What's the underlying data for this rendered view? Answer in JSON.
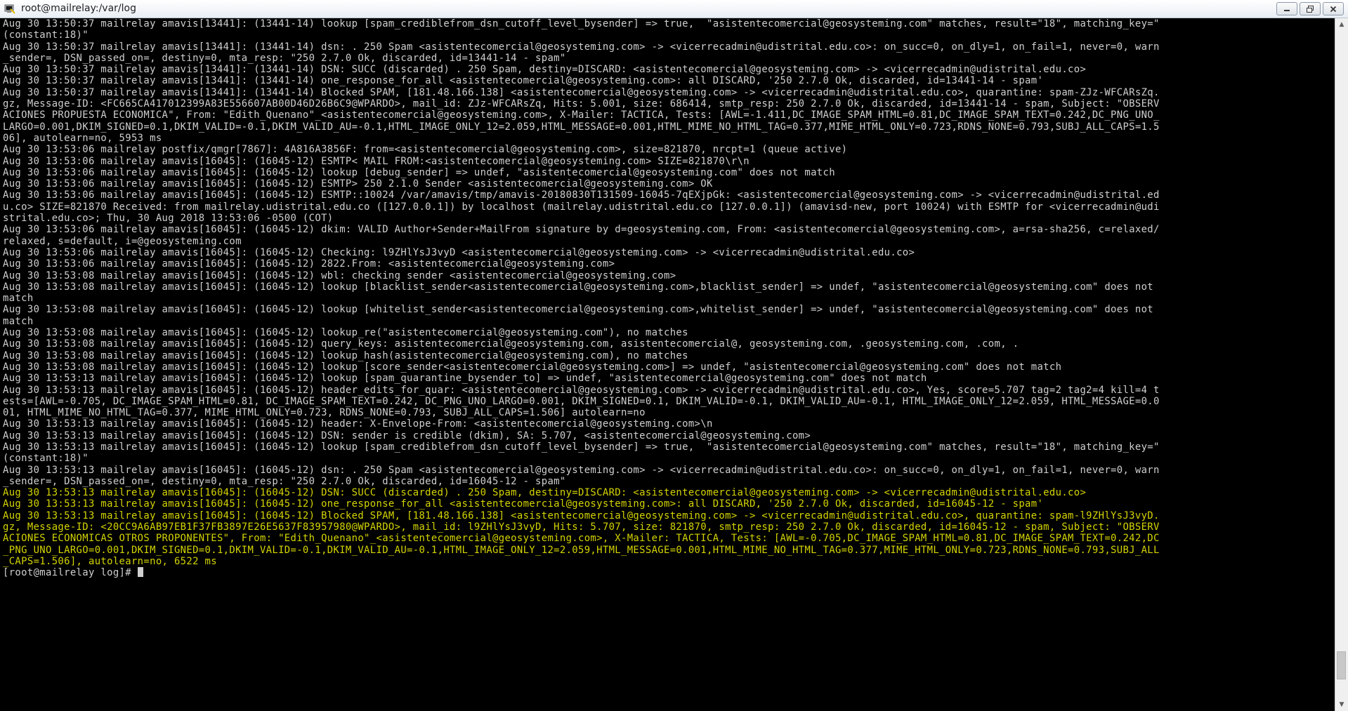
{
  "window": {
    "title": "root@mailrelay:/var/log",
    "icons": {
      "app": "putty-terminal-icon",
      "minimize": "minimize-icon",
      "maximize": "maximize-icon",
      "close": "close-icon"
    }
  },
  "terminal": {
    "scroll_position": 0.97,
    "lines": [
      {
        "text": "Aug 30 13:50:37 mailrelay amavis[13441]: (13441-14) lookup [spam_crediblefrom_dsn_cutoff_level_bysender] => true,  \"asistentecomercial@geosysteming.com\" matches, result=\"18\", matching_key=\"",
        "hl": false
      },
      {
        "text": "(constant:18)\"",
        "hl": false
      },
      {
        "text": "Aug 30 13:50:37 mailrelay amavis[13441]: (13441-14) dsn: . 250 Spam <asistentecomercial@geosysteming.com> -> <vicerrecadmin@udistrital.edu.co>: on_succ=0, on_dly=1, on_fail=1, never=0, warn",
        "hl": false
      },
      {
        "text": "_sender=, DSN_passed_on=, destiny=0, mta_resp: \"250 2.7.0 Ok, discarded, id=13441-14 - spam\"",
        "hl": false
      },
      {
        "text": "Aug 30 13:50:37 mailrelay amavis[13441]: (13441-14) DSN: SUCC (discarded) . 250 Spam, destiny=DISCARD: <asistentecomercial@geosysteming.com> -> <vicerrecadmin@udistrital.edu.co>",
        "hl": false
      },
      {
        "text": "Aug 30 13:50:37 mailrelay amavis[13441]: (13441-14) one_response_for_all <asistentecomercial@geosysteming.com>: all DISCARD, '250 2.7.0 Ok, discarded, id=13441-14 - spam'",
        "hl": false
      },
      {
        "text": "Aug 30 13:50:37 mailrelay amavis[13441]: (13441-14) Blocked SPAM, [181.48.166.138] <asistentecomercial@geosysteming.com> -> <vicerrecadmin@udistrital.edu.co>, quarantine: spam-ZJz-WFCARsZq.",
        "hl": false
      },
      {
        "text": "gz, Message-ID: <FC665CA417012399A83E556607AB00D46D26B6C9@WPARDO>, mail_id: ZJz-WFCARsZq, Hits: 5.001, size: 686414, smtp_resp: 250 2.7.0 Ok, discarded, id=13441-14 - spam, Subject: \"OBSERV",
        "hl": false
      },
      {
        "text": "ACIONES PROPUESTA ECONOMICA\", From: \"Edith_Quenano\"_<asistentecomercial@geosysteming.com>, X-Mailer: TACTICA, Tests: [AWL=-1.411,DC_IMAGE_SPAM_HTML=0.81,DC_IMAGE_SPAM_TEXT=0.242,DC_PNG_UNO_",
        "hl": false
      },
      {
        "text": "LARGO=0.001,DKIM_SIGNED=0.1,DKIM_VALID=-0.1,DKIM_VALID_AU=-0.1,HTML_IMAGE_ONLY_12=2.059,HTML_MESSAGE=0.001,HTML_MIME_NO_HTML_TAG=0.377,MIME_HTML_ONLY=0.723,RDNS_NONE=0.793,SUBJ_ALL_CAPS=1.5",
        "hl": false
      },
      {
        "text": "06], autolearn=no, 5953 ms",
        "hl": false
      },
      {
        "text": "Aug 30 13:53:06 mailrelay postfix/qmgr[7867]: 4A816A3856F: from=<asistentecomercial@geosysteming.com>, size=821870, nrcpt=1 (queue active)",
        "hl": false
      },
      {
        "text": "Aug 30 13:53:06 mailrelay amavis[16045]: (16045-12) ESMTP< MAIL FROM:<asistentecomercial@geosysteming.com> SIZE=821870\\r\\n",
        "hl": false
      },
      {
        "text": "Aug 30 13:53:06 mailrelay amavis[16045]: (16045-12) lookup [debug_sender] => undef, \"asistentecomercial@geosysteming.com\" does not match",
        "hl": false
      },
      {
        "text": "Aug 30 13:53:06 mailrelay amavis[16045]: (16045-12) ESMTP> 250 2.1.0 Sender <asistentecomercial@geosysteming.com> OK",
        "hl": false
      },
      {
        "text": "Aug 30 13:53:06 mailrelay amavis[16045]: (16045-12) ESMTP::10024 /var/amavis/tmp/amavis-20180830T131509-16045-7qEXjpGk: <asistentecomercial@geosysteming.com> -> <vicerrecadmin@udistrital.ed",
        "hl": false
      },
      {
        "text": "u.co> SIZE=821870 Received: from mailrelay.udistrital.edu.co ([127.0.0.1]) by localhost (mailrelay.udistrital.edu.co [127.0.0.1]) (amavisd-new, port 10024) with ESMTP for <vicerrecadmin@udi",
        "hl": false
      },
      {
        "text": "strital.edu.co>; Thu, 30 Aug 2018 13:53:06 -0500 (COT)",
        "hl": false
      },
      {
        "text": "Aug 30 13:53:06 mailrelay amavis[16045]: (16045-12) dkim: VALID Author+Sender+MailFrom signature by d=geosysteming.com, From: <asistentecomercial@geosysteming.com>, a=rsa-sha256, c=relaxed/",
        "hl": false
      },
      {
        "text": "relaxed, s=default, i=@geosysteming.com",
        "hl": false
      },
      {
        "text": "Aug 30 13:53:06 mailrelay amavis[16045]: (16045-12) Checking: l9ZHlYsJ3vyD <asistentecomercial@geosysteming.com> -> <vicerrecadmin@udistrital.edu.co>",
        "hl": false
      },
      {
        "text": "Aug 30 13:53:06 mailrelay amavis[16045]: (16045-12) 2822.From: <asistentecomercial@geosysteming.com>",
        "hl": false
      },
      {
        "text": "Aug 30 13:53:08 mailrelay amavis[16045]: (16045-12) wbl: checking sender <asistentecomercial@geosysteming.com>",
        "hl": false
      },
      {
        "text": "Aug 30 13:53:08 mailrelay amavis[16045]: (16045-12) lookup [blacklist_sender<asistentecomercial@geosysteming.com>,blacklist_sender] => undef, \"asistentecomercial@geosysteming.com\" does not",
        "hl": false
      },
      {
        "text": "match",
        "hl": false
      },
      {
        "text": "Aug 30 13:53:08 mailrelay amavis[16045]: (16045-12) lookup [whitelist_sender<asistentecomercial@geosysteming.com>,whitelist_sender] => undef, \"asistentecomercial@geosysteming.com\" does not",
        "hl": false
      },
      {
        "text": "match",
        "hl": false
      },
      {
        "text": "Aug 30 13:53:08 mailrelay amavis[16045]: (16045-12) lookup_re(\"asistentecomercial@geosysteming.com\"), no matches",
        "hl": false
      },
      {
        "text": "Aug 30 13:53:08 mailrelay amavis[16045]: (16045-12) query_keys: asistentecomercial@geosysteming.com, asistentecomercial@, geosysteming.com, .geosysteming.com, .com, .",
        "hl": false
      },
      {
        "text": "Aug 30 13:53:08 mailrelay amavis[16045]: (16045-12) lookup_hash(asistentecomercial@geosysteming.com), no matches",
        "hl": false
      },
      {
        "text": "Aug 30 13:53:08 mailrelay amavis[16045]: (16045-12) lookup [score_sender<asistentecomercial@geosysteming.com>] => undef, \"asistentecomercial@geosysteming.com\" does not match",
        "hl": false
      },
      {
        "text": "Aug 30 13:53:13 mailrelay amavis[16045]: (16045-12) lookup [spam_quarantine_bysender_to] => undef, \"asistentecomercial@geosysteming.com\" does not match",
        "hl": false
      },
      {
        "text": "Aug 30 13:53:13 mailrelay amavis[16045]: (16045-12) header_edits_for_quar: <asistentecomercial@geosysteming.com> -> <vicerrecadmin@udistrital.edu.co>, Yes, score=5.707 tag=2 tag2=4 kill=4 t",
        "hl": false
      },
      {
        "text": "ests=[AWL=-0.705, DC_IMAGE_SPAM_HTML=0.81, DC_IMAGE_SPAM_TEXT=0.242, DC_PNG_UNO_LARGO=0.001, DKIM_SIGNED=0.1, DKIM_VALID=-0.1, DKIM_VALID_AU=-0.1, HTML_IMAGE_ONLY_12=2.059, HTML_MESSAGE=0.0",
        "hl": false
      },
      {
        "text": "01, HTML_MIME_NO_HTML_TAG=0.377, MIME_HTML_ONLY=0.723, RDNS_NONE=0.793, SUBJ_ALL_CAPS=1.506] autolearn=no",
        "hl": false
      },
      {
        "text": "Aug 30 13:53:13 mailrelay amavis[16045]: (16045-12) header: X-Envelope-From: <asistentecomercial@geosysteming.com>\\n",
        "hl": false
      },
      {
        "text": "Aug 30 13:53:13 mailrelay amavis[16045]: (16045-12) DSN: sender is credible (dkim), SA: 5.707, <asistentecomercial@geosysteming.com>",
        "hl": false
      },
      {
        "text": "Aug 30 13:53:13 mailrelay amavis[16045]: (16045-12) lookup [spam_crediblefrom_dsn_cutoff_level_bysender] => true,  \"asistentecomercial@geosysteming.com\" matches, result=\"18\", matching_key=\"",
        "hl": false
      },
      {
        "text": "(constant:18)\"",
        "hl": false
      },
      {
        "text": "Aug 30 13:53:13 mailrelay amavis[16045]: (16045-12) dsn: . 250 Spam <asistentecomercial@geosysteming.com> -> <vicerrecadmin@udistrital.edu.co>: on_succ=0, on_dly=1, on_fail=1, never=0, warn",
        "hl": false
      },
      {
        "text": "_sender=, DSN_passed_on=, destiny=0, mta_resp: \"250 2.7.0 Ok, discarded, id=16045-12 - spam\"",
        "hl": false
      },
      {
        "text": "Aug 30 13:53:13 mailrelay amavis[16045]: (16045-12) DSN: SUCC (discarded) . 250 Spam, destiny=DISCARD: <asistentecomercial@geosysteming.com> -> <vicerrecadmin@udistrital.edu.co>",
        "hl": true
      },
      {
        "text": "Aug 30 13:53:13 mailrelay amavis[16045]: (16045-12) one_response_for_all <asistentecomercial@geosysteming.com>: all DISCARD, '250 2.7.0 Ok, discarded, id=16045-12 - spam'",
        "hl": true
      },
      {
        "text": "Aug 30 13:53:13 mailrelay amavis[16045]: (16045-12) Blocked SPAM, [181.48.166.138] <asistentecomercial@geosysteming.com> -> <vicerrecadmin@udistrital.edu.co>, quarantine: spam-l9ZHlYsJ3vyD.",
        "hl": true
      },
      {
        "text": "gz, Message-ID: <20CC9A6AB97EB1F37FB3897E26E5637F83957980@WPARDO>, mail_id: l9ZHlYsJ3vyD, Hits: 5.707, size: 821870, smtp_resp: 250 2.7.0 Ok, discarded, id=16045-12 - spam, Subject: \"OBSERV",
        "hl": true
      },
      {
        "text": "ACIONES ECONOMICAS OTROS PROPONENTES\", From: \"Edith_Quenano\"_<asistentecomercial@geosysteming.com>, X-Mailer: TACTICA, Tests: [AWL=-0.705,DC_IMAGE_SPAM_HTML=0.81,DC_IMAGE_SPAM_TEXT=0.242,DC",
        "hl": true
      },
      {
        "text": "_PNG_UNO_LARGO=0.001,DKIM_SIGNED=0.1,DKIM_VALID=-0.1,DKIM_VALID_AU=-0.1,HTML_IMAGE_ONLY_12=2.059,HTML_MESSAGE=0.001,HTML_MIME_NO_HTML_TAG=0.377,MIME_HTML_ONLY=0.723,RDNS_NONE=0.793,SUBJ_ALL",
        "hl": true
      },
      {
        "text": "_CAPS=1.506], autolearn=no, 6522 ms",
        "hl": true
      }
    ],
    "prompt": "[root@mailrelay log]# "
  },
  "colors": {
    "background": "#000000",
    "text": "#cfcfcf",
    "highlight": "#d4d400"
  }
}
